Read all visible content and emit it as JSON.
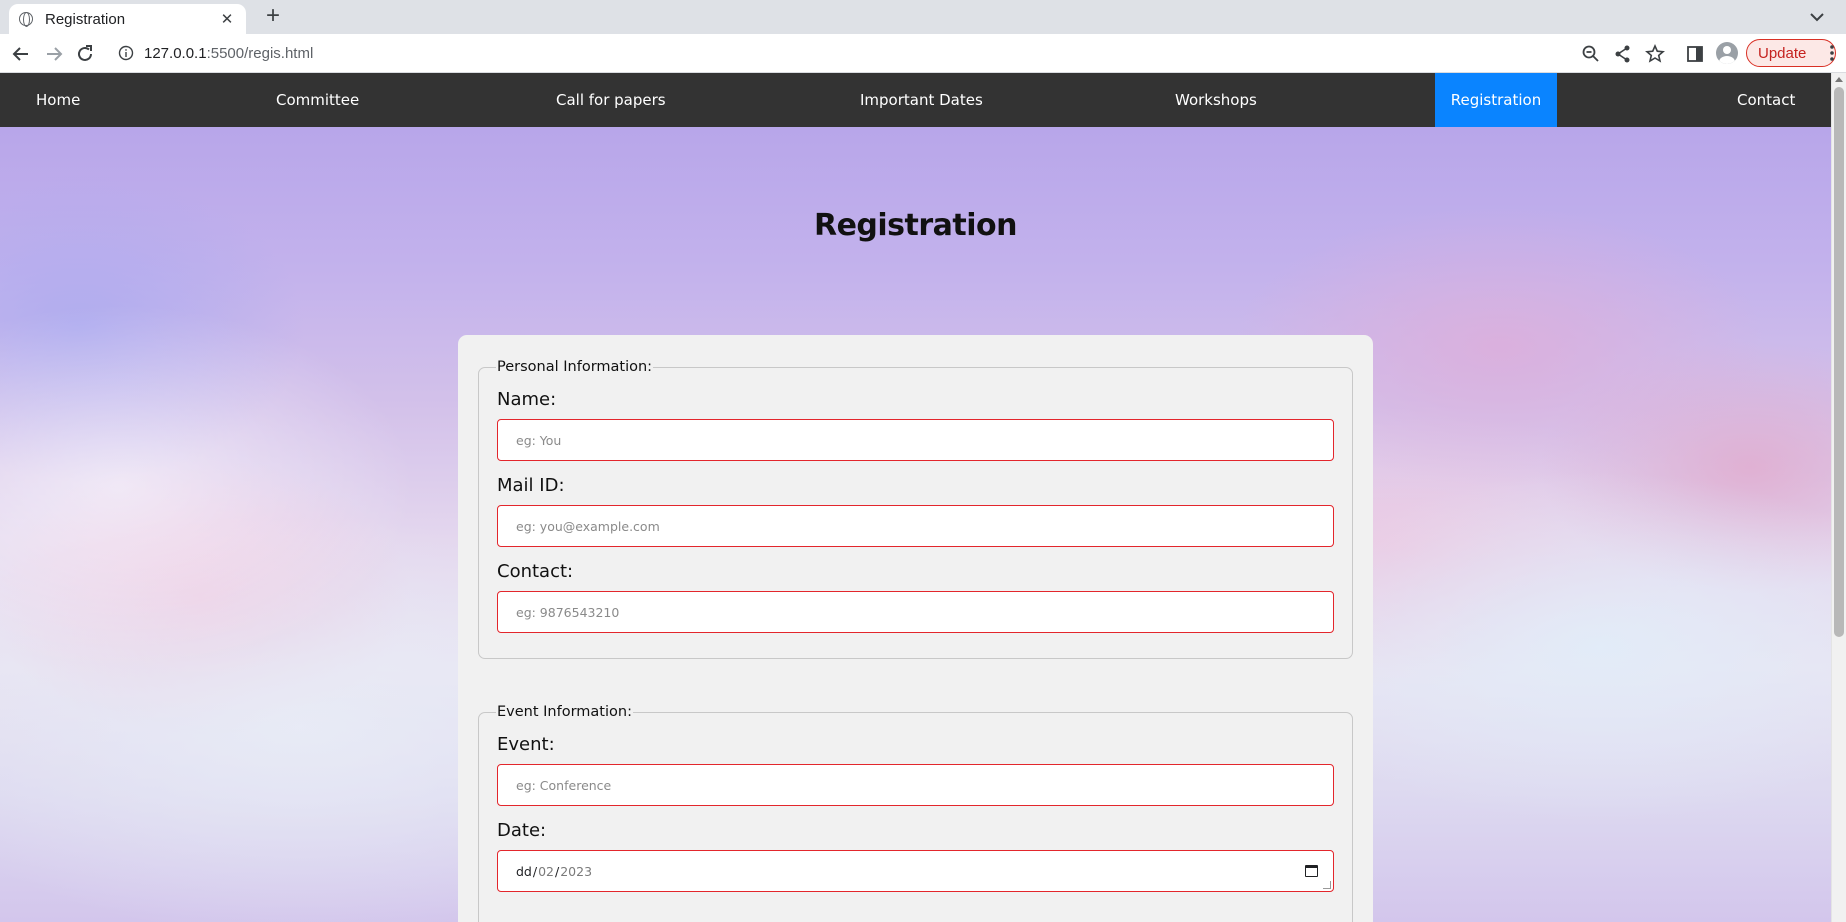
{
  "browser": {
    "tab_title": "Registration",
    "new_tab": "+",
    "url_host": "127.0.0.1",
    "url_path": ":5500/regis.html",
    "update_label": "Update"
  },
  "nav": {
    "items": [
      {
        "label": "Home"
      },
      {
        "label": "Committee"
      },
      {
        "label": "Call for papers"
      },
      {
        "label": "Important Dates"
      },
      {
        "label": "Workshops"
      },
      {
        "label": "Registration",
        "active": true
      },
      {
        "label": "Contact"
      }
    ],
    "active_color": "#0a84ff",
    "background": "#333333"
  },
  "page": {
    "title": "Registration"
  },
  "personal": {
    "legend": "Personal Information:",
    "name_label": "Name:",
    "name_placeholder": "eg: You",
    "mail_label": "Mail ID:",
    "mail_placeholder": "eg: you@example.com",
    "contact_label": "Contact:",
    "contact_placeholder": "eg: 9876543210"
  },
  "event": {
    "legend": "Event Information:",
    "event_label": "Event:",
    "event_placeholder": "eg: Conference",
    "date_label": "Date:",
    "date_day": "dd",
    "date_sep": "/",
    "date_month": "02",
    "date_year": "2023"
  },
  "colors": {
    "input_border": "#e3262c",
    "card_bg": "#f1f1f1"
  }
}
